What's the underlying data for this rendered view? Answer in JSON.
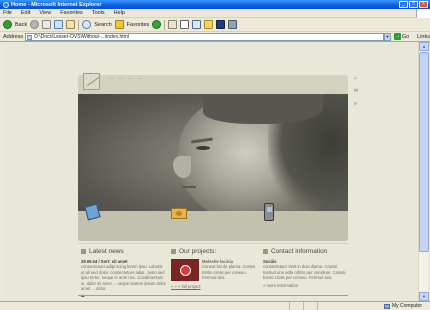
{
  "window": {
    "title": "Home - Microsoft Internet Explorer"
  },
  "menu": [
    "File",
    "Edit",
    "View",
    "Favorites",
    "Tools",
    "Help"
  ],
  "toolbar": {
    "back": "Back",
    "search": "Search",
    "favorites": "Favorites"
  },
  "address": {
    "label": "Address",
    "value": "D:\\Docs\\Lesser-OVS\\Without-...\\index.html",
    "go": "Go",
    "links": "Links"
  },
  "site": {
    "nav_dots": "— — — —",
    "news": {
      "title": "Latest news",
      "date": "29.09.04 / Sort: sit amet",
      "text": "consectetuer adipi scing lorem ipsu. Loboris ut ali sed dolor. consectetuer adipi. Justo sed ipsu tortor. neque in ante nec. Condimentum in. dolor sit amet ... neque laorem ipsum dolor amet ... dolor.",
      "more": "..."
    },
    "projects": {
      "title": "Our projects:",
      "name": "Molestie lacinia",
      "text": "Coneat list de plama. Conssi tostro cross per conseu. Fermod ans.",
      "all_link": "» » » full project"
    },
    "contact": {
      "title": "Contact information",
      "name": "Sociiis",
      "text": "consectetuer Vest in duis diama. Conssi tostrud una adta orbtro per consilum. Conssi tostro cross per conseu. Fermod ans.",
      "more": "» more information"
    }
  },
  "status": {
    "zone": "My Computer"
  }
}
